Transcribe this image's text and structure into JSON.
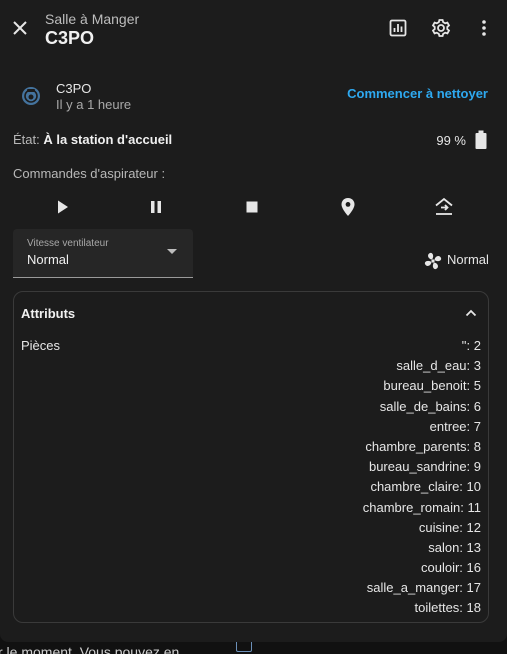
{
  "header": {
    "subtitle": "Salle à Manger",
    "title": "C3PO",
    "close_icon": "close-icon",
    "history_icon": "chart-icon",
    "settings_icon": "gear-icon",
    "menu_icon": "dots-vertical-icon"
  },
  "entity": {
    "name": "C3PO",
    "last_changed": "Il y a 1 heure",
    "action": "Commencer à nettoyer",
    "icon": "robot-vacuum-icon"
  },
  "status": {
    "label": "État:",
    "value": "À la station d'accueil",
    "battery": "99 %",
    "battery_icon": "battery-full-icon"
  },
  "commands": {
    "label": "Commandes d'aspirateur :",
    "buttons": [
      "play-icon",
      "pause-icon",
      "stop-icon",
      "locate-icon",
      "return-home-icon"
    ]
  },
  "fan_speed": {
    "label": "Vitesse ventilateur",
    "value": "Normal",
    "current": "Normal"
  },
  "attributes": {
    "title": "Attributs",
    "rooms_label": "Pièces",
    "rooms": [
      "'': 2",
      "salle_d_eau: 3",
      "bureau_benoit: 5",
      "salle_de_bains: 6",
      "entree: 7",
      "chambre_parents: 8",
      "bureau_sandrine: 9",
      "chambre_claire: 10",
      "chambre_romain: 11",
      "cuisine: 12",
      "salon: 13",
      "couloir: 16",
      "salle_a_manger: 17",
      "toilettes: 18"
    ]
  },
  "background": {
    "partial_text": "r le moment. Vous pouvez en"
  },
  "colors": {
    "accent": "#2ea9f0",
    "surface": "#1c1c1c",
    "text": "#e1e1e1"
  }
}
